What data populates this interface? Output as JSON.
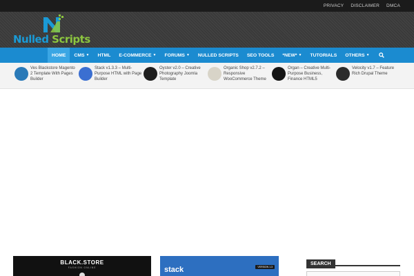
{
  "top_links": [
    "PRIVACY",
    "DISCLAIMER",
    "DMCA"
  ],
  "logo": {
    "word1": "Nulled",
    "word2": "Scripts",
    "colors": {
      "primary": "#1a9ad6",
      "secondary": "#8cc63f"
    }
  },
  "nav": {
    "items": [
      {
        "label": "HOME",
        "caret": false,
        "active": true
      },
      {
        "label": "CMS",
        "caret": true
      },
      {
        "label": "HTML",
        "caret": false
      },
      {
        "label": "E-COMMERCE",
        "caret": true
      },
      {
        "label": "FORUMS",
        "caret": true
      },
      {
        "label": "NULLED SCRIPTS",
        "caret": false
      },
      {
        "label": "SEO TOOLS",
        "caret": false
      },
      {
        "label": "*NEW*",
        "caret": true
      },
      {
        "label": "TUTORIALS",
        "caret": false
      },
      {
        "label": "OTHERS",
        "caret": true
      }
    ],
    "search_icon": "search-icon",
    "bar_color": "#1b8bd0"
  },
  "ticker": [
    {
      "title": "Ves Blackstore Magento 2 Template With Pages Builder",
      "thumb_color": "#2a7ab8"
    },
    {
      "title": "Stack v1.3.3 – Multi-Purpose HTML with Page Builder",
      "thumb_color": "#3b6fd1"
    },
    {
      "title": "Oyster v2.0 – Creative Photography Joomla Template",
      "thumb_color": "#1e1e1e"
    },
    {
      "title": "Organic Shop v2.7.2 – Responsive WooCommerce Theme",
      "thumb_color": "#d8d4c8"
    },
    {
      "title": "Organ – Creative Multi-Purpose Business, Finance HTML5",
      "thumb_color": "#151515"
    },
    {
      "title": "Velocity v1.7 – Feature Rich Drupal Theme",
      "thumb_color": "#2b2b2b"
    }
  ],
  "cards": [
    {
      "brand": "BLACK.STORE",
      "subtitle": "FASHION ONLINE"
    },
    {
      "brand": "stack",
      "badge": "VERSION 1.3"
    }
  ],
  "sidebar": {
    "search_title": "SEARCH"
  }
}
